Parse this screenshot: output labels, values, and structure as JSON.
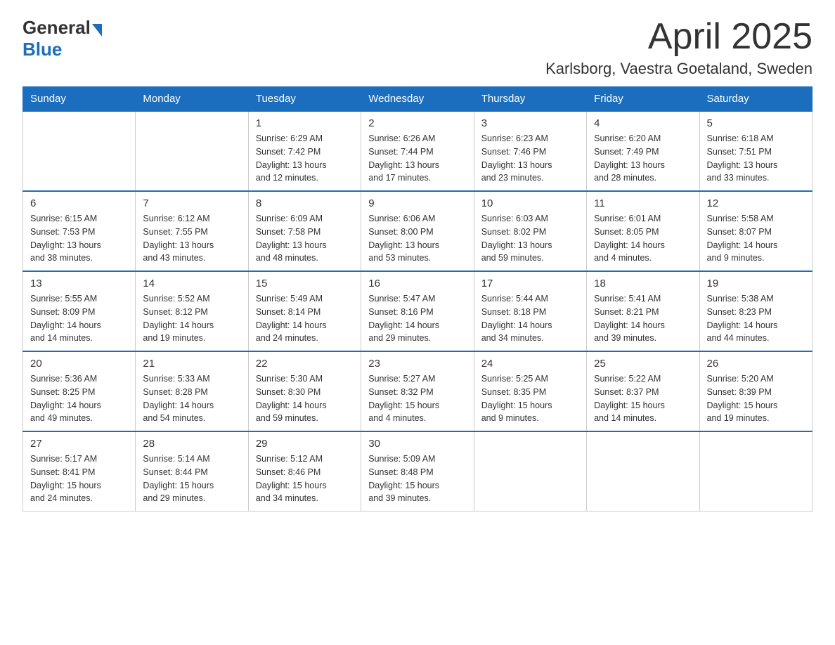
{
  "header": {
    "logo_general": "General",
    "logo_blue": "Blue",
    "month_title": "April 2025",
    "location": "Karlsborg, Vaestra Goetaland, Sweden"
  },
  "weekdays": [
    "Sunday",
    "Monday",
    "Tuesday",
    "Wednesday",
    "Thursday",
    "Friday",
    "Saturday"
  ],
  "weeks": [
    [
      {
        "day": "",
        "info": ""
      },
      {
        "day": "",
        "info": ""
      },
      {
        "day": "1",
        "info": "Sunrise: 6:29 AM\nSunset: 7:42 PM\nDaylight: 13 hours\nand 12 minutes."
      },
      {
        "day": "2",
        "info": "Sunrise: 6:26 AM\nSunset: 7:44 PM\nDaylight: 13 hours\nand 17 minutes."
      },
      {
        "day": "3",
        "info": "Sunrise: 6:23 AM\nSunset: 7:46 PM\nDaylight: 13 hours\nand 23 minutes."
      },
      {
        "day": "4",
        "info": "Sunrise: 6:20 AM\nSunset: 7:49 PM\nDaylight: 13 hours\nand 28 minutes."
      },
      {
        "day": "5",
        "info": "Sunrise: 6:18 AM\nSunset: 7:51 PM\nDaylight: 13 hours\nand 33 minutes."
      }
    ],
    [
      {
        "day": "6",
        "info": "Sunrise: 6:15 AM\nSunset: 7:53 PM\nDaylight: 13 hours\nand 38 minutes."
      },
      {
        "day": "7",
        "info": "Sunrise: 6:12 AM\nSunset: 7:55 PM\nDaylight: 13 hours\nand 43 minutes."
      },
      {
        "day": "8",
        "info": "Sunrise: 6:09 AM\nSunset: 7:58 PM\nDaylight: 13 hours\nand 48 minutes."
      },
      {
        "day": "9",
        "info": "Sunrise: 6:06 AM\nSunset: 8:00 PM\nDaylight: 13 hours\nand 53 minutes."
      },
      {
        "day": "10",
        "info": "Sunrise: 6:03 AM\nSunset: 8:02 PM\nDaylight: 13 hours\nand 59 minutes."
      },
      {
        "day": "11",
        "info": "Sunrise: 6:01 AM\nSunset: 8:05 PM\nDaylight: 14 hours\nand 4 minutes."
      },
      {
        "day": "12",
        "info": "Sunrise: 5:58 AM\nSunset: 8:07 PM\nDaylight: 14 hours\nand 9 minutes."
      }
    ],
    [
      {
        "day": "13",
        "info": "Sunrise: 5:55 AM\nSunset: 8:09 PM\nDaylight: 14 hours\nand 14 minutes."
      },
      {
        "day": "14",
        "info": "Sunrise: 5:52 AM\nSunset: 8:12 PM\nDaylight: 14 hours\nand 19 minutes."
      },
      {
        "day": "15",
        "info": "Sunrise: 5:49 AM\nSunset: 8:14 PM\nDaylight: 14 hours\nand 24 minutes."
      },
      {
        "day": "16",
        "info": "Sunrise: 5:47 AM\nSunset: 8:16 PM\nDaylight: 14 hours\nand 29 minutes."
      },
      {
        "day": "17",
        "info": "Sunrise: 5:44 AM\nSunset: 8:18 PM\nDaylight: 14 hours\nand 34 minutes."
      },
      {
        "day": "18",
        "info": "Sunrise: 5:41 AM\nSunset: 8:21 PM\nDaylight: 14 hours\nand 39 minutes."
      },
      {
        "day": "19",
        "info": "Sunrise: 5:38 AM\nSunset: 8:23 PM\nDaylight: 14 hours\nand 44 minutes."
      }
    ],
    [
      {
        "day": "20",
        "info": "Sunrise: 5:36 AM\nSunset: 8:25 PM\nDaylight: 14 hours\nand 49 minutes."
      },
      {
        "day": "21",
        "info": "Sunrise: 5:33 AM\nSunset: 8:28 PM\nDaylight: 14 hours\nand 54 minutes."
      },
      {
        "day": "22",
        "info": "Sunrise: 5:30 AM\nSunset: 8:30 PM\nDaylight: 14 hours\nand 59 minutes."
      },
      {
        "day": "23",
        "info": "Sunrise: 5:27 AM\nSunset: 8:32 PM\nDaylight: 15 hours\nand 4 minutes."
      },
      {
        "day": "24",
        "info": "Sunrise: 5:25 AM\nSunset: 8:35 PM\nDaylight: 15 hours\nand 9 minutes."
      },
      {
        "day": "25",
        "info": "Sunrise: 5:22 AM\nSunset: 8:37 PM\nDaylight: 15 hours\nand 14 minutes."
      },
      {
        "day": "26",
        "info": "Sunrise: 5:20 AM\nSunset: 8:39 PM\nDaylight: 15 hours\nand 19 minutes."
      }
    ],
    [
      {
        "day": "27",
        "info": "Sunrise: 5:17 AM\nSunset: 8:41 PM\nDaylight: 15 hours\nand 24 minutes."
      },
      {
        "day": "28",
        "info": "Sunrise: 5:14 AM\nSunset: 8:44 PM\nDaylight: 15 hours\nand 29 minutes."
      },
      {
        "day": "29",
        "info": "Sunrise: 5:12 AM\nSunset: 8:46 PM\nDaylight: 15 hours\nand 34 minutes."
      },
      {
        "day": "30",
        "info": "Sunrise: 5:09 AM\nSunset: 8:48 PM\nDaylight: 15 hours\nand 39 minutes."
      },
      {
        "day": "",
        "info": ""
      },
      {
        "day": "",
        "info": ""
      },
      {
        "day": "",
        "info": ""
      }
    ]
  ]
}
